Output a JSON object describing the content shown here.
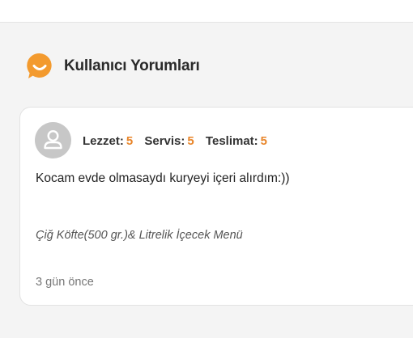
{
  "section": {
    "title": "Kullanıcı Yorumları",
    "icon": "smile-chat-icon",
    "accent_color": "#f39a2e"
  },
  "review": {
    "avatar_icon": "user-icon",
    "ratings": [
      {
        "label": "Lezzet:",
        "value": "5"
      },
      {
        "label": "Servis:",
        "value": "5"
      },
      {
        "label": "Teslimat:",
        "value": "5"
      }
    ],
    "text": "Kocam evde olmasaydı kuryeyi içeri alırdım:))",
    "ordered_item": "Çiğ Köfte(500 gr.)& Litrelik İçecek Menü",
    "date": "3 gün önce"
  }
}
